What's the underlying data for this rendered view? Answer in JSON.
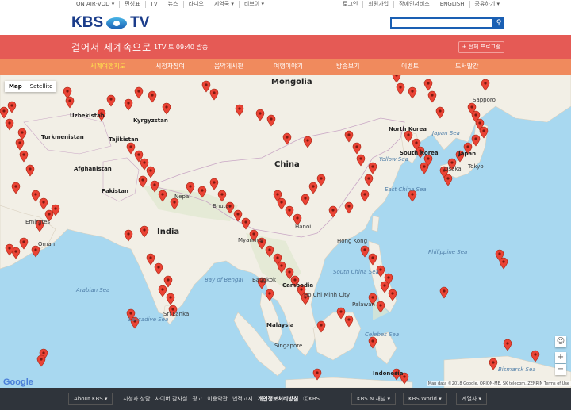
{
  "topbar": {
    "left": [
      "ON AIR·VOD ▾",
      "편성표",
      "TV",
      "뉴스",
      "라디오",
      "지역국 ▾",
      "티브이 ▾"
    ],
    "right": [
      "로그인",
      "회원가입",
      "장애인서비스",
      "ENGLISH",
      "공유하기 ▾"
    ]
  },
  "logo": {
    "left": "KBS",
    "right": "TV"
  },
  "search": {
    "value": ""
  },
  "header": {
    "program_title": "걸어서 세계속으로",
    "airtime": "1TV 토 09:40 방송",
    "all_programs": "+ 전체 프로그램"
  },
  "nav": {
    "tabs": [
      "세계여행지도",
      "시청자참여",
      "음악게시판",
      "여행이야기",
      "방송보기",
      "이벤트",
      "도서발간"
    ]
  },
  "map": {
    "type_buttons": [
      "Map",
      "Satellite"
    ],
    "labels": {
      "mongolia": "Mongolia",
      "uzbekistan": "Uzbekistan",
      "kyrgyzstan": "Kyrgyzstan",
      "turkmenistan": "Turkmenistan",
      "tajikistan": "Tajikistan",
      "afghanistan": "Afghanistan",
      "pakistan": "Pakistan",
      "india": "India",
      "china": "China",
      "nepal": "Nepal",
      "bhutan": "Bhutan",
      "north_korea": "North Korea",
      "south_korea": "South Korea",
      "japan": "Japan",
      "sapporo": "Sapporo",
      "osaka": "Osaka",
      "tokyo": "Tokyo",
      "sea_of_japan": "Japan Sea",
      "yellow_sea": "Yellow Sea",
      "east_china_sea": "East China Sea",
      "hong_kong": "Hong Kong",
      "south_china_sea": "South China Sea",
      "philippine_sea": "Philippine Sea",
      "bangkok": "Bangkok",
      "cambodia": "Cambodia",
      "ho_chi_minh": "Ho Chi Minh City",
      "malaysia": "Malaysia",
      "singapore": "Singapore",
      "arabian_sea": "Arabian Sea",
      "laccadive_sea": "Laccadive Sea",
      "sri_lanka": "Sri Lanka",
      "myanmar": "Myanmar",
      "celebes_sea": "Celebes Sea",
      "indonesia": "Indonesia",
      "bismarck_sea": "Bismarck Sea",
      "emirates": "Emirates",
      "oman": "Oman",
      "palawan": "Palawan",
      "hanoi": "Hanoi",
      "bengal": "Bay of Bengal"
    },
    "google": "Google",
    "attribution": "Map data ©2018 Google, ORION-ME, SK telecom, ZENRIN  Terms of Use"
  },
  "footer": {
    "about": "About KBS ▾",
    "links": [
      "시청자 상담",
      "사이버 감사실",
      "광고",
      "이용약관",
      "법적고지",
      "개인정보처리방침",
      "ⓒKBS"
    ],
    "kbsn": "KBS N 채널 ▾",
    "kbsworld": "KBS World ▾",
    "affiliates": "계열사 ▾"
  }
}
